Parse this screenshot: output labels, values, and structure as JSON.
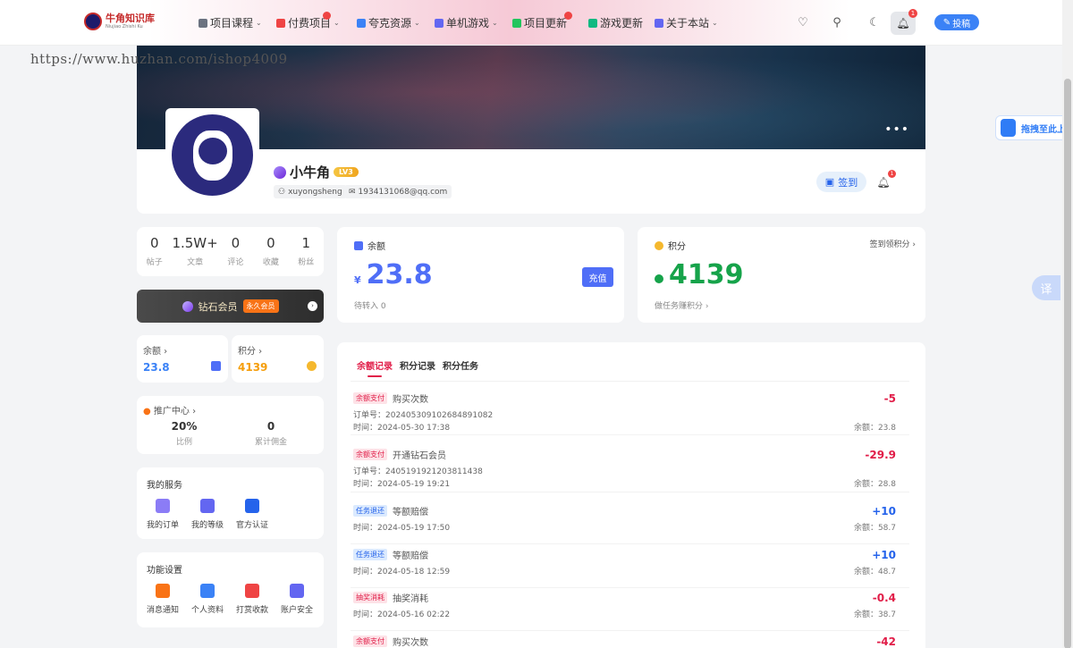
{
  "nav": {
    "logo_text": "牛角知识库",
    "logo_sub": "Niujiao Zhishi Ku",
    "items": [
      {
        "label": "项目课程",
        "color": "#6b7280",
        "has_menu": true
      },
      {
        "label": "付费项目",
        "color": "#ef4444",
        "has_menu": true,
        "badge": true
      },
      {
        "label": "夸克资源",
        "color": "#3b82f6",
        "has_menu": true
      },
      {
        "label": "单机游戏",
        "color": "#6366f1",
        "has_menu": true
      },
      {
        "label": "项目更新",
        "color": "#22c55e",
        "has_menu": false,
        "badge": true
      },
      {
        "label": "游戏更新",
        "color": "#10b981",
        "has_menu": false
      },
      {
        "label": "关于本站",
        "color": "#6366f1",
        "has_menu": true
      }
    ],
    "bell_count": "1",
    "post_label": "投稿"
  },
  "watermark": "https://www.huzhan.com/ishop4009",
  "profile": {
    "name": "小牛角",
    "level": "LV3",
    "username": "xuyongsheng",
    "email": "1934131068@qq.com",
    "sign_label": "签到",
    "bell_count": "1",
    "more": "•••"
  },
  "stats": [
    {
      "num": "0",
      "label": "帖子"
    },
    {
      "num": "1.5W+",
      "label": "文章"
    },
    {
      "num": "0",
      "label": "评论"
    },
    {
      "num": "0",
      "label": "收藏"
    },
    {
      "num": "1",
      "label": "粉丝"
    }
  ],
  "vip": {
    "label": "钻石会员",
    "tag": "永久会员",
    "go": "›"
  },
  "mini_balance": {
    "label": "余额 ›",
    "value": "23.8",
    "color": "#3b82f6"
  },
  "mini_points": {
    "label": "积分 ›",
    "value": "4139",
    "color": "#f59e0b"
  },
  "promo": {
    "title": "推广中心 ›",
    "ratio": "20%",
    "ratio_label": "比例",
    "commission": "0",
    "commission_label": "累计佣金"
  },
  "services": {
    "title": "我的服务",
    "items": [
      {
        "label": "我的订单",
        "icon": "order-icon",
        "color": "#8b7cf6"
      },
      {
        "label": "我的等级",
        "icon": "level-icon",
        "color": "#6366f1"
      },
      {
        "label": "官方认证",
        "icon": "verified-icon",
        "color": "#2563eb"
      }
    ]
  },
  "settings": {
    "title": "功能设置",
    "items": [
      {
        "label": "消息通知",
        "icon": "notification-icon",
        "color": "#f97316"
      },
      {
        "label": "个人资料",
        "icon": "profile-icon",
        "color": "#3b82f6"
      },
      {
        "label": "打赏收款",
        "icon": "gift-icon",
        "color": "#ef4444"
      },
      {
        "label": "账户安全",
        "icon": "shield-icon",
        "color": "#6366f1"
      }
    ]
  },
  "balance": {
    "title": "余额",
    "currency": "¥",
    "value": "23.8",
    "pending": "待转入 0",
    "charge_label": "充值",
    "color": "#4f6ef7"
  },
  "points": {
    "title": "积分",
    "value": "4139",
    "sub": "做任务赚积分 ›",
    "link": "签到领积分 ›",
    "color": "#16a34a"
  },
  "records": {
    "tabs": [
      "余额记录",
      "积分记录",
      "积分任务"
    ],
    "items": [
      {
        "tag": "余额支付",
        "tag_color": "#e11d48",
        "tag_bg": "#fde2e7",
        "title": "购买次数",
        "order": "订单号：20240530910268489​1082",
        "time": "时间：2024-05-30 17:38",
        "amount": "-5",
        "amount_color": "#e11d48",
        "balance": "余额：23.8"
      },
      {
        "tag": "余额支付",
        "tag_color": "#e11d48",
        "tag_bg": "#fde2e7",
        "title": "开通钻石会员",
        "order": "订单号：2405191921203811438",
        "time": "时间：2024-05-19 19:21",
        "amount": "-29.9",
        "amount_color": "#e11d48",
        "balance": "余额：28.8"
      },
      {
        "tag": "任务退还",
        "tag_color": "#2563eb",
        "tag_bg": "#dbeafe",
        "title": "等额赔偿",
        "order": "",
        "time": "时间：2024-05-19 17:50",
        "amount": "+10",
        "amount_color": "#2563eb",
        "balance": "余额：58.7"
      },
      {
        "tag": "任务退还",
        "tag_color": "#2563eb",
        "tag_bg": "#dbeafe",
        "title": "等额赔偿",
        "order": "",
        "time": "时间：2024-05-18 12:59",
        "amount": "+10",
        "amount_color": "#2563eb",
        "balance": "余额：48.7"
      },
      {
        "tag": "抽奖消耗",
        "tag_color": "#e11d48",
        "tag_bg": "#fde2e7",
        "title": "抽奖消耗",
        "order": "",
        "time": "时间：2024-05-16 02:22",
        "amount": "-0.4",
        "amount_color": "#e11d48",
        "balance": "余额：38.7"
      },
      {
        "tag": "余额支付",
        "tag_color": "#e11d48",
        "tag_bg": "#fde2e7",
        "title": "购买次数",
        "order": "",
        "time": "",
        "amount": "-42",
        "amount_color": "#e11d48",
        "balance": ""
      }
    ]
  },
  "floating": {
    "upload_label": "拖拽至此上传",
    "translate_label": "译"
  }
}
